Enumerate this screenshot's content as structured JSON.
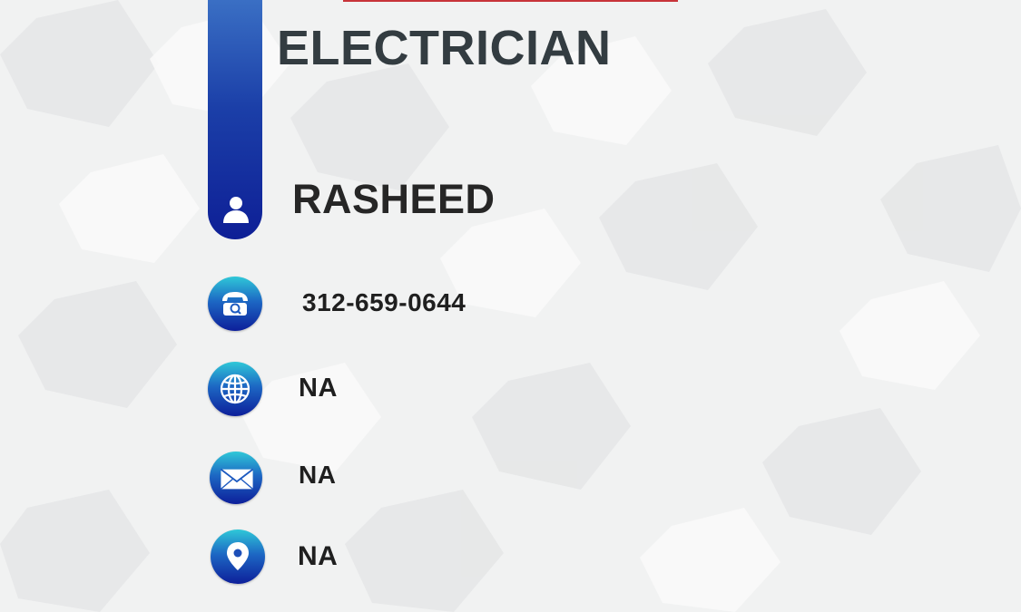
{
  "header": {
    "title": "ELECTRICIAN"
  },
  "contact": {
    "name": "RASHEED",
    "phone": "312-659-0644",
    "website": "NA",
    "email": "NA",
    "address": "NA"
  },
  "icons": [
    "user-icon",
    "phone-icon",
    "globe-icon",
    "mail-icon",
    "location-pin-icon"
  ],
  "colors": {
    "accent_red": "#c8343a",
    "bar_blue_top": "#3a6fc4",
    "bar_blue_bottom": "#0e1f96",
    "circle_cyan": "#2fc8d8",
    "text_dark": "#333c41"
  }
}
